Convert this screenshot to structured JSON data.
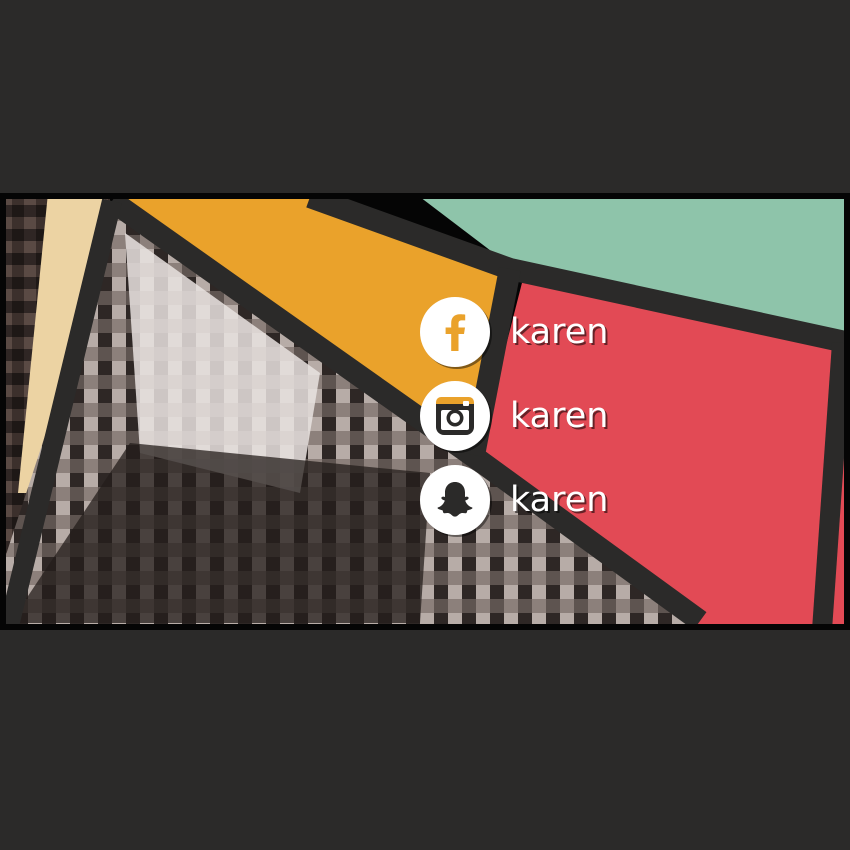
{
  "social": [
    {
      "network": "facebook",
      "icon": "facebook-icon",
      "handle": "karen"
    },
    {
      "network": "instagram",
      "icon": "instagram-icon",
      "handle": "karen"
    },
    {
      "network": "snapchat",
      "icon": "snapchat-icon",
      "handle": "karen"
    }
  ],
  "colors": {
    "background": "#2b2a29",
    "border": "#2b2a29",
    "orange": "#eaa22b",
    "teal": "#8ec4aa",
    "red": "#e24a55",
    "icon_dark": "#2b2a29"
  }
}
